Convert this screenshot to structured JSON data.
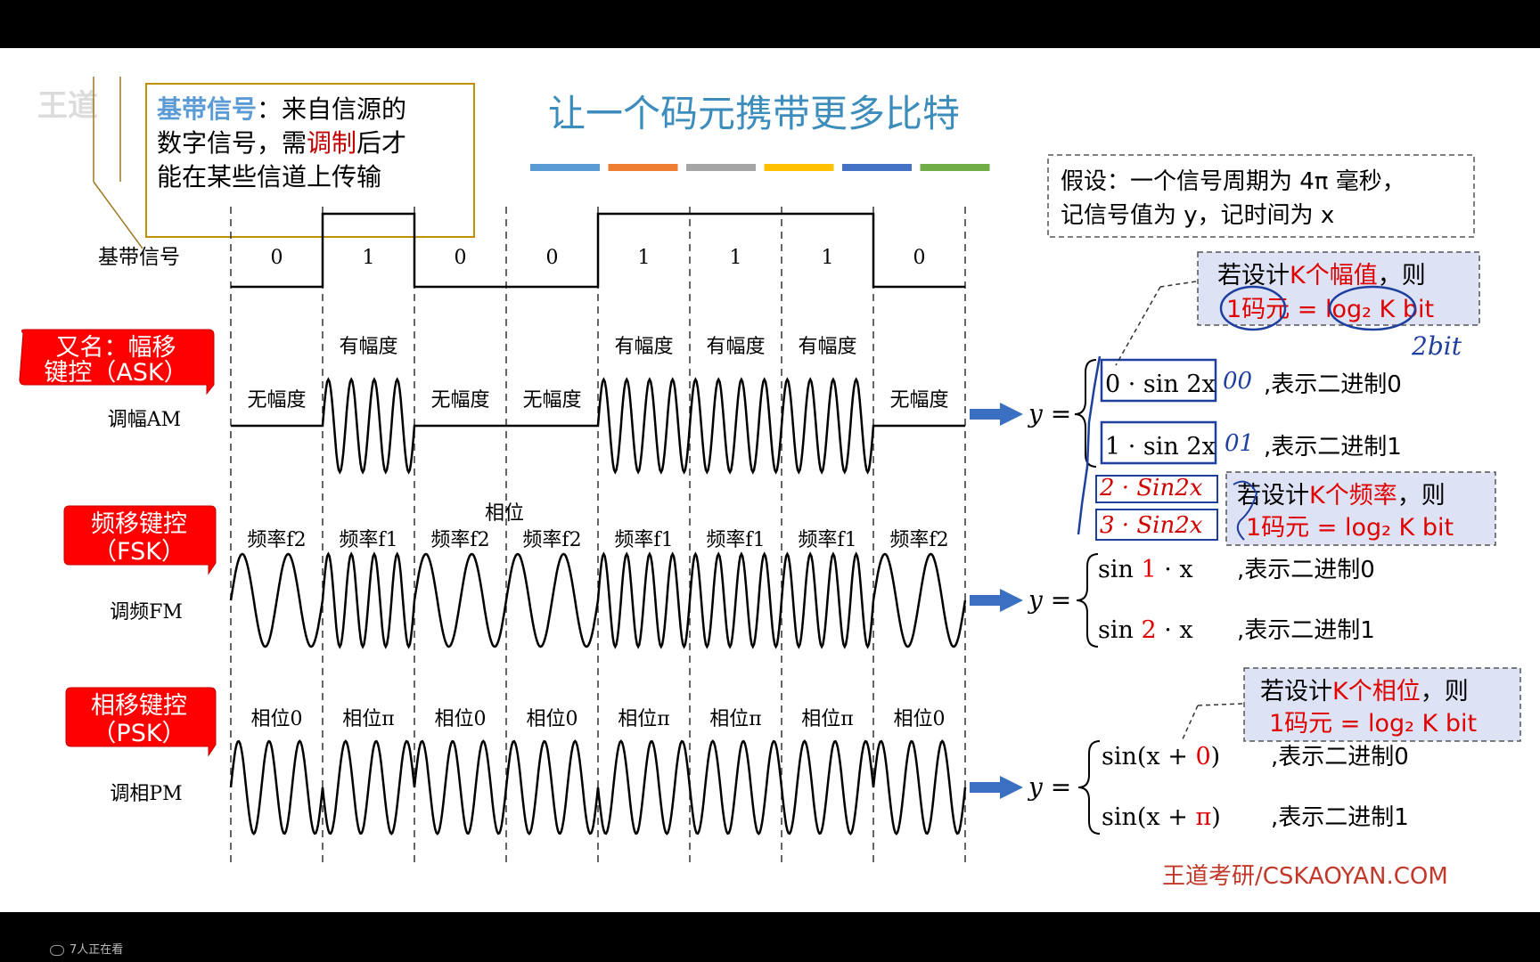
{
  "title": "让一个码元携带更多比特",
  "title_colors": [
    "#5b9bd5",
    "#ed7d31",
    "#a5a5a5",
    "#ffc000",
    "#4472c4",
    "#70ad47"
  ],
  "intro_box": {
    "term": "基带信号",
    "colon": "：",
    "line1_rest": "来自信源的",
    "line2_a": "数字信号，需",
    "line2_hl": "调制",
    "line2_b": "后才",
    "line3": "能在某些信道上传输"
  },
  "assumption": {
    "line1": "假设：一个信号周期为 4π 毫秒，",
    "line2": "记信号值为 y，记时间为 x"
  },
  "baseband": {
    "label": "基带信号",
    "bits": [
      "0",
      "1",
      "0",
      "0",
      "1",
      "1",
      "1",
      "0"
    ]
  },
  "ask": {
    "badge_line1": "又名：幅移",
    "badge_line2": "键控（ASK）",
    "sub": "调幅AM",
    "labels": [
      "无幅度",
      "有幅度",
      "无幅度",
      "无幅度",
      "有幅度",
      "有幅度",
      "有幅度",
      "无幅度"
    ]
  },
  "fsk": {
    "badge_line1": "频移键控",
    "badge_line2": "（FSK）",
    "sub": "调频FM",
    "phase_note": "相位",
    "labels": [
      "频率f2",
      "频率f1",
      "频率f2",
      "频率f2",
      "频率f1",
      "频率f1",
      "频率f1",
      "频率f2"
    ]
  },
  "psk": {
    "badge_line1": "相移键控",
    "badge_line2": "（PSK）",
    "sub": "调相PM",
    "labels": [
      "相位0",
      "相位π",
      "相位0",
      "相位0",
      "相位π",
      "相位π",
      "相位π",
      "相位0"
    ]
  },
  "formulas": {
    "y_eq": "y =",
    "ask": [
      {
        "expr": "0 · sin 2x",
        "note": ",表示二进制0"
      },
      {
        "expr": "1 · sin 2x",
        "note": ",表示二进制1"
      }
    ],
    "fsk": [
      {
        "pre": "sin ",
        "hl": "1",
        "post": " · x",
        "note": ",表示二进制0"
      },
      {
        "pre": "sin ",
        "hl": "2",
        "post": " · x",
        "note": ",表示二进制1"
      }
    ],
    "psk": [
      {
        "pre": "sin(x + ",
        "hl": "0",
        "post": ")",
        "note": ",表示二进制0"
      },
      {
        "pre": "sin(x + ",
        "hl": "π",
        "post": ")",
        "note": ",表示二进制1"
      }
    ]
  },
  "callouts": {
    "amp": {
      "l1a": "若设计",
      "l1b": "K个幅值",
      "l1c": "，则",
      "l2a": "1码元",
      "l2b": " = log₂ K bit"
    },
    "freq": {
      "l1a": "若设计",
      "l1b": "K个频率",
      "l1c": "，则",
      "l2a": "1码元",
      "l2b": " = log₂ K bit"
    },
    "phase": {
      "l1a": "若设计",
      "l1b": "K个相位",
      "l1c": "，则",
      "l2a": "1码元",
      "l2b": " = log₂ K bit"
    }
  },
  "handwriting": {
    "bits": "2bit",
    "c1": "00",
    "c2": "01",
    "s3": "2 · Sin2x",
    "s4": "3 · Sin2x"
  },
  "footer": "王道考研/CSKAOYAN.COM",
  "overlay_logo": "王道",
  "viewers": "7人正在看"
}
